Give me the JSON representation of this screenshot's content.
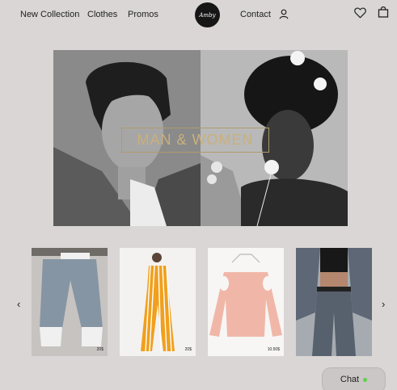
{
  "nav": {
    "new_collection": "New Collection",
    "clothes": "Clothes",
    "promos": "Promos",
    "contact": "Contact",
    "logo_text": "Amby"
  },
  "hero": {
    "caption": "MAN & WOMEN"
  },
  "products": [
    {
      "price": "20$"
    },
    {
      "price": "20$"
    },
    {
      "price": "10.50$"
    },
    {
      "price": ""
    }
  ],
  "carousel": {
    "prev": "‹",
    "next": "›"
  },
  "chat": {
    "label": "Chat",
    "status_color": "#5bd34b"
  },
  "colors": {
    "background": "#d9d6d5",
    "caption_gold": "#c9b07c"
  }
}
